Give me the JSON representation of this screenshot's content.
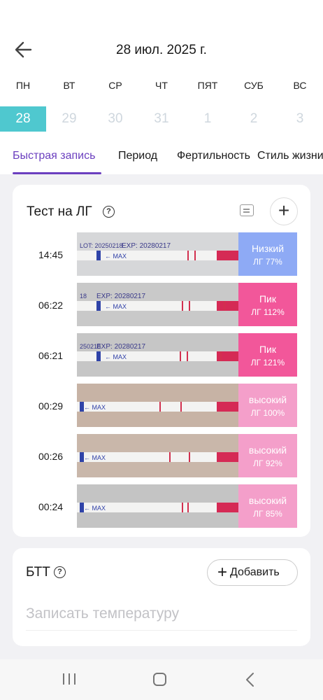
{
  "header": {
    "date": "28 июл. 2025 г."
  },
  "calendar": {
    "weekdays": [
      "ПН",
      "ВТ",
      "СР",
      "ЧТ",
      "ПЯТ",
      "СУБ",
      "ВС"
    ],
    "days": [
      "28",
      "29",
      "30",
      "31",
      "1",
      "2",
      "3"
    ],
    "selected_day": "28"
  },
  "tabs": [
    "Быстрая запись",
    "Период",
    "Фертильность",
    "Стиль жизни"
  ],
  "active_tab": "Быстрая запись",
  "lh_card": {
    "title": "Тест на ЛГ",
    "records": [
      {
        "time": "14:45",
        "level": "Низкий",
        "value": "ЛГ 77%",
        "color": "#8eaaf5"
      },
      {
        "time": "06:22",
        "level": "Пик",
        "value": "ЛГ 112%",
        "color": "#f2579a"
      },
      {
        "time": "06:21",
        "level": "Пик",
        "value": "ЛГ 121%",
        "color": "#f2579a"
      },
      {
        "time": "00:29",
        "level": "высокий",
        "value": "ЛГ 100%",
        "color": "#f49fca"
      },
      {
        "time": "00:26",
        "level": "высокий",
        "value": "ЛГ 92%",
        "color": "#f49fca"
      },
      {
        "time": "00:24",
        "level": "высокий",
        "value": "ЛГ 85%",
        "color": "#f49fca"
      }
    ],
    "strip_texts": [
      {
        "lot": "LOT: 20250218",
        "exp": "EXP: 20280217",
        "max": "MAX"
      },
      {
        "lot": "18",
        "exp": "EXP: 20280217",
        "max": "MAX"
      },
      {
        "lot": "250218",
        "exp": "EXP: 20280217",
        "max": "MAX"
      },
      {
        "lot": "",
        "exp": "",
        "max": "MAX"
      },
      {
        "lot": "",
        "exp": "",
        "max": "MAX"
      },
      {
        "lot": "",
        "exp": "",
        "max": "MAX"
      }
    ]
  },
  "btt_card": {
    "title": "БТТ",
    "add_label": "Добавить",
    "placeholder": "Записать температуру"
  },
  "colors": {
    "accent": "#6b3fbf",
    "selected_day": "#4fc8cf"
  }
}
